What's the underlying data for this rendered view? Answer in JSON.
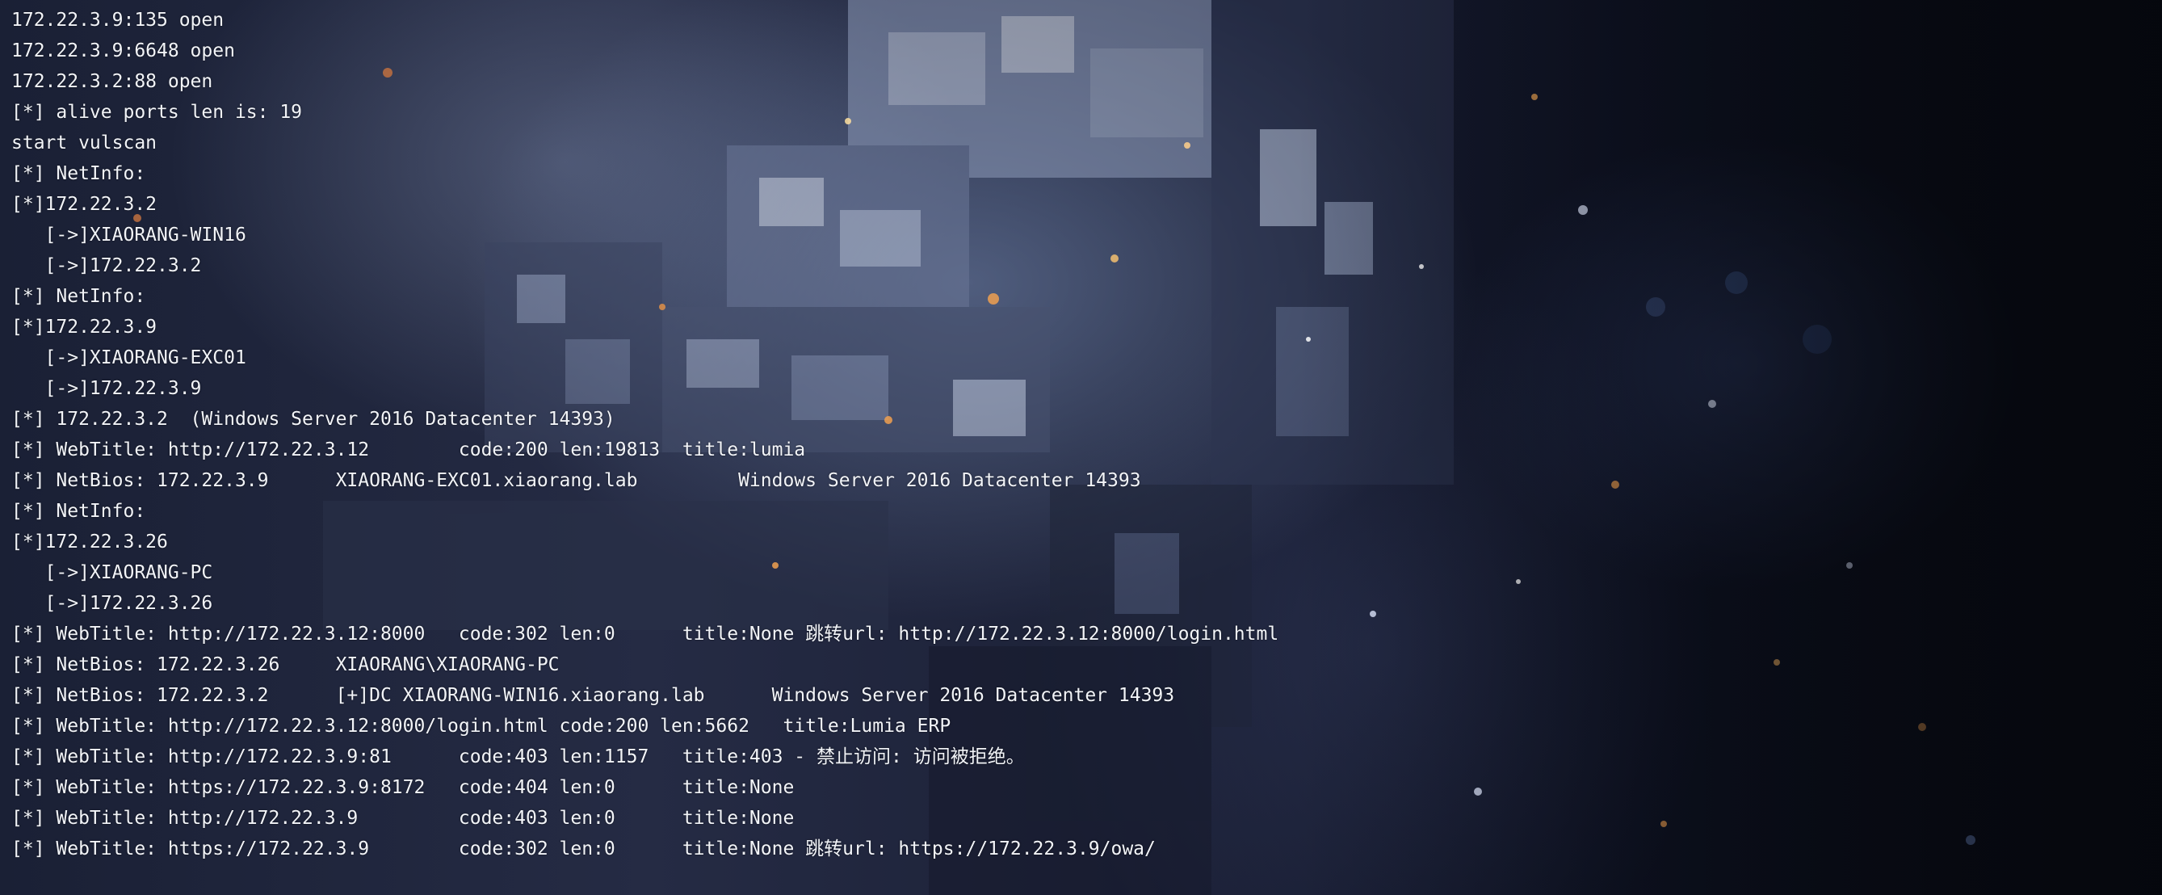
{
  "terminal": {
    "lines": [
      "172.22.3.9:135 open",
      "172.22.3.9:6648 open",
      "172.22.3.2:88 open",
      "[*] alive ports len is: 19",
      "start vulscan",
      "[*] NetInfo:",
      "[*]172.22.3.2",
      "   [->]XIAORANG-WIN16",
      "   [->]172.22.3.2",
      "[*] NetInfo:",
      "[*]172.22.3.9",
      "   [->]XIAORANG-EXC01",
      "   [->]172.22.3.9",
      "[*] 172.22.3.2  (Windows Server 2016 Datacenter 14393)",
      "[*] WebTitle: http://172.22.3.12        code:200 len:19813  title:lumia",
      "[*] NetBios: 172.22.3.9      XIAORANG-EXC01.xiaorang.lab         Windows Server 2016 Datacenter 14393",
      "[*] NetInfo:",
      "[*]172.22.3.26",
      "   [->]XIAORANG-PC",
      "   [->]172.22.3.26",
      "[*] WebTitle: http://172.22.3.12:8000   code:302 len:0      title:None 跳转url: http://172.22.3.12:8000/login.html",
      "[*] NetBios: 172.22.3.26     XIAORANG\\XIAORANG-PC",
      "[*] NetBios: 172.22.3.2      [+]DC XIAORANG-WIN16.xiaorang.lab      Windows Server 2016 Datacenter 14393",
      "[*] WebTitle: http://172.22.3.12:8000/login.html code:200 len:5662   title:Lumia ERP",
      "[*] WebTitle: http://172.22.3.9:81      code:403 len:1157   title:403 - 禁止访问: 访问被拒绝。",
      "[*] WebTitle: https://172.22.3.9:8172   code:404 len:0      title:None",
      "[*] WebTitle: http://172.22.3.9         code:403 len:0      title:None",
      "[*] WebTitle: https://172.22.3.9        code:302 len:0      title:None 跳转url: https://172.22.3.9/owa/"
    ]
  },
  "colors": {
    "text": "#f2f4f8",
    "background": "#1a2035",
    "accent_glow": "#f0a050"
  }
}
